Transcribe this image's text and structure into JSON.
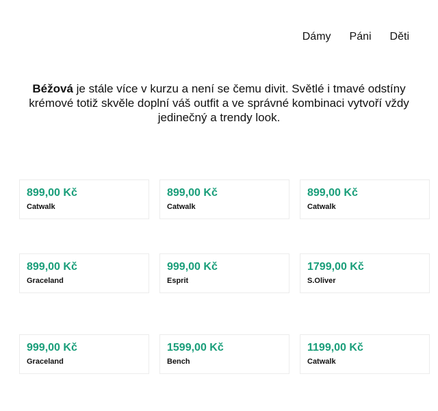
{
  "nav": {
    "items": [
      {
        "label": "Dámy"
      },
      {
        "label": "Páni"
      },
      {
        "label": "Děti"
      }
    ]
  },
  "intro": {
    "bold": "Béžová",
    "text": " je stále více v kurzu a není se čemu divit. Světlé i tmavé odstíny krémové totiž skvěle doplní váš outfit a ve správné kombinaci vytvoří vždy jedinečný a trendy look."
  },
  "products": [
    {
      "price": "899,00 Kč",
      "brand": "Catwalk"
    },
    {
      "price": "899,00 Kč",
      "brand": "Catwalk"
    },
    {
      "price": "899,00 Kč",
      "brand": "Catwalk"
    },
    {
      "price": "899,00 Kč",
      "brand": "Graceland"
    },
    {
      "price": "999,00 Kč",
      "brand": "Esprit"
    },
    {
      "price": "1799,00 Kč",
      "brand": "S.Oliver"
    },
    {
      "price": "999,00 Kč",
      "brand": "Graceland"
    },
    {
      "price": "1599,00 Kč",
      "brand": "Bench"
    },
    {
      "price": "1199,00 Kč",
      "brand": "Catwalk"
    }
  ],
  "colors": {
    "price": "#1a9e7a",
    "text": "#111111",
    "card_border": "#ececec"
  }
}
